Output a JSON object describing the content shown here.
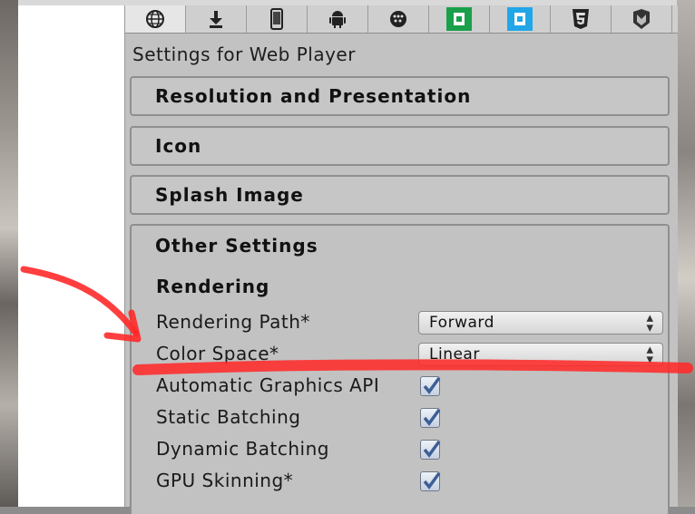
{
  "tabs": [
    {
      "icon": "globe-icon",
      "active": true
    },
    {
      "icon": "download-icon",
      "active": false
    },
    {
      "icon": "mobile-device-icon",
      "active": false
    },
    {
      "icon": "android-icon",
      "active": false
    },
    {
      "icon": "blackberry-icon",
      "active": false
    },
    {
      "icon": "windows-store-green-icon",
      "active": false
    },
    {
      "icon": "windows-store-blue-icon",
      "active": false
    },
    {
      "icon": "html5-icon",
      "active": false
    },
    {
      "icon": "unity-shield-icon",
      "active": false
    }
  ],
  "title": "Settings for Web Player",
  "sections": {
    "resolution": "Resolution and Presentation",
    "icon": "Icon",
    "splash": "Splash Image",
    "other": "Other Settings"
  },
  "other": {
    "rendering_heading": "Rendering",
    "rendering_path_label": "Rendering Path*",
    "rendering_path_value": "Forward",
    "color_space_label": "Color Space*",
    "color_space_value": "Linear",
    "checkboxes": [
      {
        "label": "Automatic Graphics API",
        "checked": true
      },
      {
        "label": "Static Batching",
        "checked": true
      },
      {
        "label": "Dynamic Batching",
        "checked": true
      },
      {
        "label": "GPU Skinning*",
        "checked": true
      }
    ]
  },
  "colors": {
    "annotation": "#ff2a2a",
    "checkmark": "#3c5f96"
  }
}
